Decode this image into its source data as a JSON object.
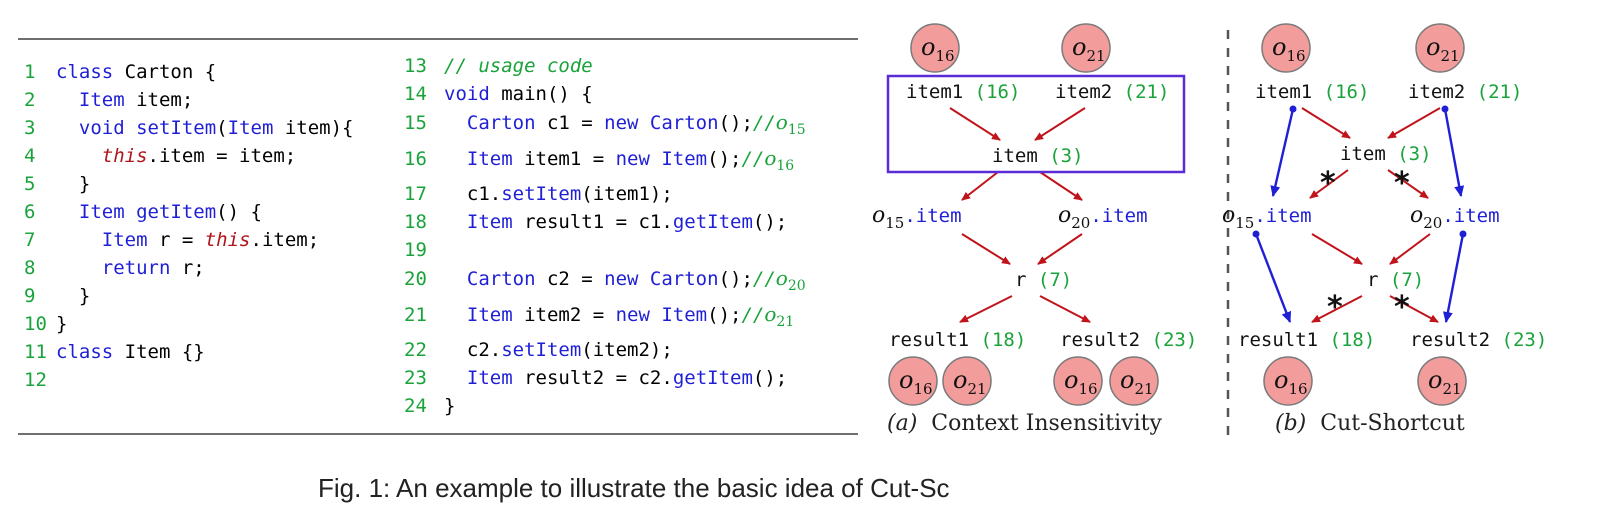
{
  "code_left": [
    {
      "n": "1",
      "t": [
        [
          "kw",
          "class"
        ],
        [
          "p",
          " Carton {"
        ]
      ]
    },
    {
      "n": "2",
      "t": [
        [
          "p",
          "  "
        ],
        [
          "kw",
          "Item"
        ],
        [
          "p",
          " item;"
        ]
      ]
    },
    {
      "n": "3",
      "t": [
        [
          "p",
          "  "
        ],
        [
          "kw",
          "void setItem"
        ],
        [
          "p",
          "("
        ],
        [
          "kw",
          "Item"
        ],
        [
          "p",
          " item){"
        ]
      ]
    },
    {
      "n": "4",
      "t": [
        [
          "p",
          "    "
        ],
        [
          "th",
          "this"
        ],
        [
          "p",
          ".item = item;"
        ]
      ]
    },
    {
      "n": "5",
      "t": [
        [
          "p",
          "  }"
        ]
      ]
    },
    {
      "n": "6",
      "t": [
        [
          "p",
          "  "
        ],
        [
          "kw",
          "Item getItem"
        ],
        [
          "p",
          "() {"
        ]
      ]
    },
    {
      "n": "7",
      "t": [
        [
          "p",
          "    "
        ],
        [
          "kw",
          "Item"
        ],
        [
          "p",
          " r = "
        ],
        [
          "th",
          "this"
        ],
        [
          "p",
          ".item;"
        ]
      ]
    },
    {
      "n": "8",
      "t": [
        [
          "p",
          "    "
        ],
        [
          "kw",
          "return"
        ],
        [
          "p",
          " r;"
        ]
      ]
    },
    {
      "n": "9",
      "t": [
        [
          "p",
          "  }"
        ]
      ]
    },
    {
      "n": "10",
      "t": [
        [
          "p",
          "}"
        ]
      ]
    },
    {
      "n": "11",
      "t": [
        [
          "kw",
          "class"
        ],
        [
          "p",
          " Item {}"
        ]
      ]
    },
    {
      "n": "12",
      "t": []
    }
  ],
  "code_right": [
    {
      "n": "13",
      "t": [
        [
          "cm",
          "// usage code"
        ]
      ]
    },
    {
      "n": "14",
      "t": [
        [
          "kw",
          "void"
        ],
        [
          "p",
          " main() {"
        ]
      ]
    },
    {
      "n": "15",
      "t": [
        [
          "p",
          "  "
        ],
        [
          "kw",
          "Carton"
        ],
        [
          "p",
          " c1 = "
        ],
        [
          "kw",
          "new Carton"
        ],
        [
          "p",
          "();"
        ],
        [
          "cm",
          "//"
        ],
        [
          "ob",
          "o|15"
        ]
      ]
    },
    {
      "n": "16",
      "t": [
        [
          "p",
          "  "
        ],
        [
          "kw",
          "Item"
        ],
        [
          "p",
          " item1 = "
        ],
        [
          "kw",
          "new Item"
        ],
        [
          "p",
          "();"
        ],
        [
          "cm",
          "//"
        ],
        [
          "ob",
          "o|16"
        ]
      ]
    },
    {
      "n": "17",
      "t": [
        [
          "p",
          "  c1."
        ],
        [
          "kw",
          "setItem"
        ],
        [
          "p",
          "(item1);"
        ]
      ]
    },
    {
      "n": "18",
      "t": [
        [
          "p",
          "  "
        ],
        [
          "kw",
          "Item"
        ],
        [
          "p",
          " result1 = c1."
        ],
        [
          "kw",
          "getItem"
        ],
        [
          "p",
          "();"
        ]
      ]
    },
    {
      "n": "19",
      "t": []
    },
    {
      "n": "20",
      "t": [
        [
          "p",
          "  "
        ],
        [
          "kw",
          "Carton"
        ],
        [
          "p",
          " c2 = "
        ],
        [
          "kw",
          "new Carton"
        ],
        [
          "p",
          "();"
        ],
        [
          "cm",
          "//"
        ],
        [
          "ob",
          "o|20"
        ]
      ]
    },
    {
      "n": "21",
      "t": [
        [
          "p",
          "  "
        ],
        [
          "kw",
          "Item"
        ],
        [
          "p",
          " item2 = "
        ],
        [
          "kw",
          "new Item"
        ],
        [
          "p",
          "();"
        ],
        [
          "cm",
          "//"
        ],
        [
          "ob",
          "o|21"
        ]
      ]
    },
    {
      "n": "22",
      "t": [
        [
          "p",
          "  c2."
        ],
        [
          "kw",
          "setItem"
        ],
        [
          "p",
          "(item2);"
        ]
      ]
    },
    {
      "n": "23",
      "t": [
        [
          "p",
          "  "
        ],
        [
          "kw",
          "Item"
        ],
        [
          "p",
          " result2 = c2."
        ],
        [
          "kw",
          "getItem"
        ],
        [
          "p",
          "();"
        ]
      ]
    },
    {
      "n": "24",
      "t": [
        [
          "p",
          "}"
        ]
      ]
    }
  ],
  "graph_a": {
    "objects": {
      "o16": "16",
      "o21": "21"
    },
    "nodes": {
      "item1": {
        "label": "item1",
        "line": "(16)"
      },
      "item2": {
        "label": "item2",
        "line": "(21)"
      },
      "item": {
        "label": "item",
        "line": "(3)"
      },
      "o15item": {
        "obj": "15",
        "field": ".item"
      },
      "o20item": {
        "obj": "20",
        "field": ".item"
      },
      "r": {
        "label": "r",
        "line": "(7)"
      },
      "result1": {
        "label": "result1",
        "line": "(18)"
      },
      "result2": {
        "label": "result2",
        "line": "(23)"
      }
    },
    "caption_label": "(a)",
    "caption_text": "Context Insensitivity"
  },
  "graph_b": {
    "caption_label": "(b)",
    "caption_text": "Cut-Shortcut"
  },
  "figure_caption": "Fig. 1: An example to illustrate the basic idea of Cut-Sc",
  "colors": {
    "flow": "#c0141a",
    "shortcut": "#1f1fd6",
    "node_fill": "#f29c9c",
    "box": "#5a2bd6",
    "line_no": "#1aa33a"
  }
}
